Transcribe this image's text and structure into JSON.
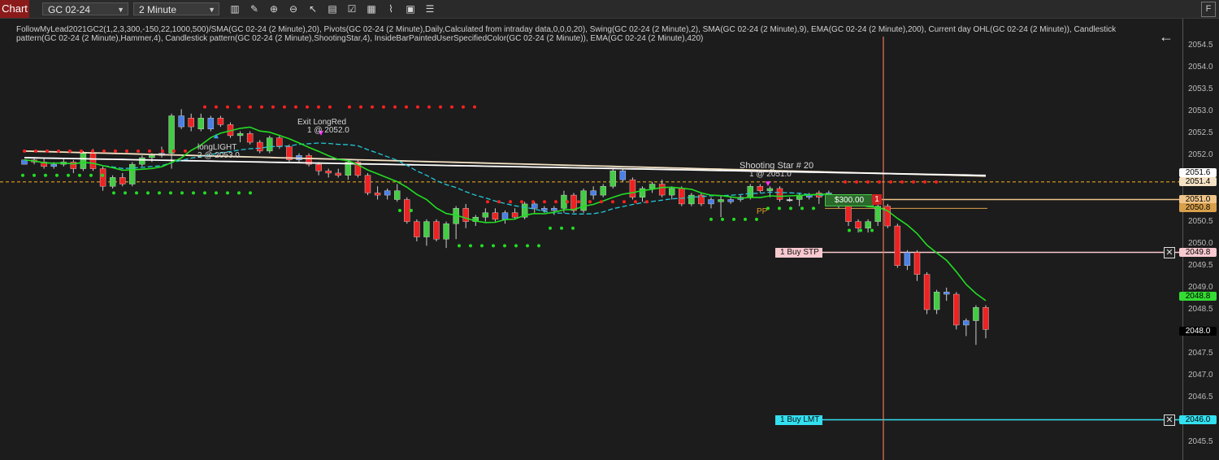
{
  "toolbar": {
    "tab_label": "Chart",
    "instrument": "GC 02-24",
    "interval": "2 Minute",
    "flag_label": "F",
    "icons": [
      "bar-type-icon",
      "draw-icon",
      "zoom-in-icon",
      "zoom-out-icon",
      "cursor-icon",
      "data-box-icon",
      "properties-icon",
      "strategy-icon",
      "indicator-icon",
      "template-icon",
      "show-trades-icon"
    ]
  },
  "indicators_text": "FollowMyLead2021GC2(1,2,3,300,-150,22,1000,500)/SMA(GC 02-24 (2 Minute),20), Pivots(GC 02-24 (2 Minute),Daily,Calculated from intraday data,0,0,0,20), Swing(GC 02-24 (2 Minute),2), SMA(GC 02-24 (2 Minute),9), EMA(GC 02-24 (2 Minute),200), Current day OHL(GC 02-24 (2 Minute)), Candlestick pattern(GC 02-24 (2 Minute),Hammer,4), Candlestick pattern(GC 02-24 (2 Minute),ShootingStar,4), InsideBarPaintedUserSpecifiedColor(GC 02-24 (2 Minute)), EMA(GC 02-24 (2 Minute),420)",
  "chart_data": {
    "type": "candlestick",
    "ylim": [
      2045.1,
      2055.2
    ],
    "y_ticks": [
      "2054.5",
      "2054.0",
      "2053.5",
      "2053.0",
      "2052.5",
      "2052.0",
      "2051.5",
      "2051.0",
      "2050.5",
      "2050.0",
      "2049.5",
      "2049.0",
      "2048.5",
      "2048.0",
      "2047.5",
      "2047.0",
      "2046.5",
      "2046.0",
      "2045.5"
    ],
    "candles": [
      [
        2051.8,
        2051.9,
        2051.8,
        2051.9,
        "#4a80e8"
      ],
      [
        2051.9,
        2051.95,
        2051.8,
        2051.85,
        "#ee2222"
      ],
      [
        2051.85,
        2051.95,
        2051.7,
        2051.75,
        "#ee2222"
      ],
      [
        2051.75,
        2051.85,
        2051.7,
        2051.8,
        "#4a80e8"
      ],
      [
        2051.8,
        2051.95,
        2051.75,
        2051.85,
        "#44cc44"
      ],
      [
        2051.85,
        2051.9,
        2051.6,
        2051.7,
        "#ee2222"
      ],
      [
        2051.7,
        2052.1,
        2051.65,
        2052.05,
        "#44cc44"
      ],
      [
        2052.05,
        2052.15,
        2051.65,
        2051.7,
        "#ee2222"
      ],
      [
        2051.7,
        2051.75,
        2051.2,
        2051.3,
        "#ee2222"
      ],
      [
        2051.3,
        2051.55,
        2051.25,
        2051.5,
        "#44cc44"
      ],
      [
        2051.5,
        2051.6,
        2051.3,
        2051.35,
        "#ee2222"
      ],
      [
        2051.35,
        2051.85,
        2051.3,
        2051.8,
        "#44cc44"
      ],
      [
        2051.8,
        2052.0,
        2051.75,
        2051.95,
        "#44cc44"
      ],
      [
        2051.95,
        2052.05,
        2051.85,
        2052.0,
        "#44cc44"
      ],
      [
        2052.0,
        2052.2,
        2051.95,
        2052.05,
        "#4a80e8"
      ],
      [
        2052.05,
        2052.95,
        2051.7,
        2052.9,
        "#44cc44"
      ],
      [
        2052.9,
        2053.05,
        2052.6,
        2052.65,
        "#4a80e8"
      ],
      [
        2052.65,
        2052.95,
        2052.55,
        2052.85,
        "#ee2222"
      ],
      [
        2052.85,
        2052.95,
        2052.55,
        2052.6,
        "#44cc44"
      ],
      [
        2052.6,
        2052.9,
        2052.55,
        2052.85,
        "#4a80e8"
      ],
      [
        2052.85,
        2052.9,
        2052.65,
        2052.7,
        "#ee2222"
      ],
      [
        2052.7,
        2052.75,
        2052.4,
        2052.45,
        "#ee2222"
      ],
      [
        2052.45,
        2052.55,
        2052.3,
        2052.5,
        "#44cc44"
      ],
      [
        2052.5,
        2052.55,
        2052.25,
        2052.3,
        "#ee2222"
      ],
      [
        2052.3,
        2052.35,
        2052.05,
        2052.1,
        "#ee2222"
      ],
      [
        2052.1,
        2052.45,
        2052.05,
        2052.4,
        "#44cc44"
      ],
      [
        2052.4,
        2052.45,
        2052.15,
        2052.2,
        "#ee2222"
      ],
      [
        2052.2,
        2052.25,
        2051.85,
        2051.9,
        "#ee2222"
      ],
      [
        2051.9,
        2052.05,
        2051.85,
        2052.0,
        "#4a80e8"
      ],
      [
        2052.0,
        2052.05,
        2051.75,
        2051.8,
        "#ee2222"
      ],
      [
        2051.8,
        2051.85,
        2051.55,
        2051.65,
        "#ee2222"
      ],
      [
        2051.65,
        2051.7,
        2051.5,
        2051.6,
        "#ee2222"
      ],
      [
        2051.6,
        2051.7,
        2051.5,
        2051.55,
        "#ee2222"
      ],
      [
        2051.55,
        2051.9,
        2051.45,
        2051.85,
        "#44cc44"
      ],
      [
        2051.85,
        2051.9,
        2051.5,
        2051.55,
        "#ee2222"
      ],
      [
        2051.55,
        2051.6,
        2051.1,
        2051.15,
        "#ee2222"
      ],
      [
        2051.15,
        2051.3,
        2051.0,
        2051.1,
        "#ee2222"
      ],
      [
        2051.1,
        2051.25,
        2051.0,
        2051.2,
        "#4a80e8"
      ],
      [
        2051.2,
        2051.35,
        2050.95,
        2051.0,
        "#44cc44"
      ],
      [
        2051.0,
        2051.05,
        2050.45,
        2050.5,
        "#ee2222"
      ],
      [
        2050.5,
        2050.55,
        2050.05,
        2050.15,
        "#ee2222"
      ],
      [
        2050.15,
        2050.55,
        2049.95,
        2050.5,
        "#44cc44"
      ],
      [
        2050.5,
        2050.55,
        2050.05,
        2050.1,
        "#ee2222"
      ],
      [
        2050.1,
        2050.5,
        2049.9,
        2050.45,
        "#44cc44"
      ],
      [
        2050.45,
        2050.85,
        2050.1,
        2050.8,
        "#44cc44"
      ],
      [
        2050.8,
        2050.9,
        2050.35,
        2050.5,
        "#ee2222"
      ],
      [
        2050.5,
        2050.65,
        2050.4,
        2050.6,
        "#44cc44"
      ],
      [
        2050.6,
        2050.8,
        2050.5,
        2050.7,
        "#44cc44"
      ],
      [
        2050.7,
        2050.8,
        2050.5,
        2050.55,
        "#ee2222"
      ],
      [
        2050.55,
        2050.75,
        2050.45,
        2050.7,
        "#4a80e8"
      ],
      [
        2050.7,
        2050.8,
        2050.55,
        2050.6,
        "#ee2222"
      ],
      [
        2050.6,
        2050.95,
        2050.55,
        2050.9,
        "#44cc44"
      ],
      [
        2050.9,
        2050.95,
        2050.7,
        2050.8,
        "#4a80e8"
      ],
      [
        2050.8,
        2050.85,
        2050.7,
        2050.75,
        "#4a80e8"
      ],
      [
        2050.75,
        2050.85,
        2050.65,
        2050.8,
        "#4a80e8"
      ],
      [
        2050.8,
        2051.2,
        2050.7,
        2051.1,
        "#44cc44"
      ],
      [
        2051.1,
        2051.15,
        2050.7,
        2050.75,
        "#ee2222"
      ],
      [
        2050.75,
        2051.25,
        2050.7,
        2051.2,
        "#44cc44"
      ],
      [
        2051.2,
        2051.3,
        2051.0,
        2051.1,
        "#4a80e8"
      ],
      [
        2051.1,
        2051.35,
        2051.05,
        2051.3,
        "#44cc44"
      ],
      [
        2051.3,
        2051.7,
        2051.25,
        2051.65,
        "#44cc44"
      ],
      [
        2051.65,
        2051.7,
        2051.4,
        2051.45,
        "#4a80e8"
      ],
      [
        2051.45,
        2051.5,
        2051.0,
        2051.05,
        "#ee2222"
      ],
      [
        2051.05,
        2051.3,
        2050.95,
        2051.25,
        "#44cc44"
      ],
      [
        2051.25,
        2051.4,
        2051.15,
        2051.35,
        "#44cc44"
      ],
      [
        2051.35,
        2051.45,
        2051.05,
        2051.1,
        "#ee2222"
      ],
      [
        2051.1,
        2051.3,
        2051.0,
        2051.25,
        "#44cc44"
      ],
      [
        2051.25,
        2051.3,
        2050.85,
        2050.9,
        "#ee2222"
      ],
      [
        2050.9,
        2051.15,
        2050.85,
        2051.1,
        "#44cc44"
      ],
      [
        2051.1,
        2051.15,
        2050.85,
        2050.9,
        "#ee2222"
      ],
      [
        2050.9,
        2051.05,
        2050.8,
        2051.0,
        "#4a80e8"
      ],
      [
        2051.0,
        2051.1,
        2050.6,
        2050.95,
        "#44cc44"
      ],
      [
        2050.95,
        2051.05,
        2050.9,
        2051.0,
        "#4a80e8"
      ],
      [
        2051.0,
        2051.1,
        2050.95,
        2051.05,
        "#4a80e8"
      ],
      [
        2051.05,
        2051.35,
        2051.0,
        2051.3,
        "#44cc44"
      ],
      [
        2051.3,
        2051.35,
        2051.15,
        2051.2,
        "#ee2222"
      ],
      [
        2051.2,
        2051.3,
        2051.05,
        2051.25,
        "#44cc44"
      ],
      [
        2051.25,
        2051.3,
        2050.95,
        2051.0,
        "#ee2222"
      ],
      [
        2051.0,
        2051.05,
        2050.95,
        2051.0,
        "#dddddd"
      ],
      [
        2051.0,
        2051.15,
        2050.85,
        2051.1,
        "#44cc44"
      ],
      [
        2051.1,
        2051.15,
        2051.0,
        2051.05,
        "#4a80e8"
      ],
      [
        2051.05,
        2051.2,
        2050.9,
        2051.15,
        "#ee2222"
      ],
      [
        2051.15,
        2051.2,
        2051.0,
        2051.05,
        "#4a80e8"
      ],
      [
        2051.05,
        2051.1,
        2050.8,
        2050.85,
        "#ee2222"
      ],
      [
        2050.85,
        2050.9,
        2050.4,
        2050.5,
        "#ee2222"
      ],
      [
        2050.5,
        2050.55,
        2050.25,
        2050.35,
        "#ee2222"
      ],
      [
        2050.35,
        2050.55,
        2050.25,
        2050.5,
        "#44cc44"
      ],
      [
        2050.5,
        2050.9,
        2050.4,
        2050.85,
        "#44cc44"
      ],
      [
        2050.85,
        2050.9,
        2050.35,
        2050.4,
        "#ee2222"
      ],
      [
        2050.4,
        2050.45,
        2049.45,
        2049.5,
        "#ee2222"
      ],
      [
        2049.5,
        2049.85,
        2049.4,
        2049.8,
        "#4a80e8"
      ],
      [
        2049.8,
        2049.85,
        2049.15,
        2049.3,
        "#ee2222"
      ],
      [
        2049.3,
        2049.35,
        2048.4,
        2048.5,
        "#ee2222"
      ],
      [
        2048.5,
        2048.95,
        2048.4,
        2048.9,
        "#44cc44"
      ],
      [
        2048.9,
        2049.0,
        2048.7,
        2048.85,
        "#4a80e8"
      ],
      [
        2048.85,
        2048.9,
        2048.05,
        2048.15,
        "#ee2222"
      ],
      [
        2048.15,
        2048.3,
        2047.9,
        2048.25,
        "#4a80e8"
      ],
      [
        2048.25,
        2048.6,
        2047.7,
        2048.55,
        "#44cc44"
      ],
      [
        2048.55,
        2048.6,
        2047.85,
        2048.05,
        "#ee2222"
      ]
    ],
    "order_buy_stp": {
      "label": "1  Buy STP",
      "price": "2049.8"
    },
    "order_buy_lmt": {
      "label": "1  Buy LMT",
      "price": "2046.0"
    },
    "position": {
      "pnl": "$300.00",
      "qty": "1",
      "price": "2051.0"
    },
    "price_tags": [
      {
        "price": "2051.6",
        "bg": "#ffffff",
        "fg": "#000000"
      },
      {
        "price": "2051.4",
        "bg": "#f4e2c4",
        "fg": "#000000"
      },
      {
        "price": "2051.0",
        "bg": "#f0c58a",
        "fg": "#000000"
      },
      {
        "price": "2050.8",
        "bg": "#d9a04a",
        "fg": "#000000"
      },
      {
        "price": "2048.8",
        "bg": "#33dd33",
        "fg": "#000000"
      },
      {
        "price": "2048.0",
        "bg": "#000000",
        "fg": "#ffffff"
      }
    ],
    "annotations": [
      {
        "text": "longLIGHT",
        "id": "ann-longlight"
      },
      {
        "text": "2 @ 2053.0",
        "id": "ann-entry"
      },
      {
        "text": "Exit LongRed",
        "id": "ann-exit"
      },
      {
        "text": "1 @ 2052.0",
        "id": "ann-exit-fill"
      },
      {
        "text": "Shooting Star # 20",
        "id": "ann-shooting"
      },
      {
        "text": "1 @ 2051.0",
        "id": "ann-fill2"
      },
      {
        "text": "PP",
        "id": "ann-pp"
      }
    ]
  }
}
